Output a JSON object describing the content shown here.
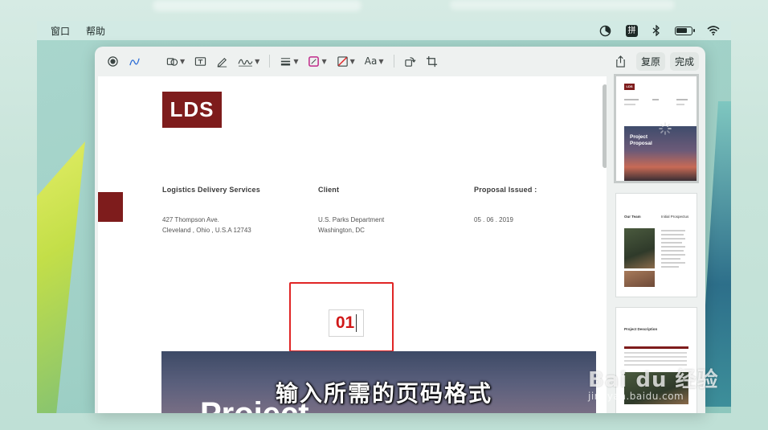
{
  "menubar": {
    "items": [
      "窗口",
      "帮助"
    ]
  },
  "toolbar": {
    "text_style_label": "Aa",
    "revert_label": "复原",
    "done_label": "完成"
  },
  "document": {
    "logo_text": "LDS",
    "columns": [
      {
        "heading": "Logistics Delivery Services",
        "lines": [
          "427 Thompson Ave.",
          "Cleveland , Ohio , U.S.A 12743"
        ]
      },
      {
        "heading": "Client",
        "lines": [
          "U.S. Parks Department",
          "Washington, DC"
        ]
      },
      {
        "heading": "Proposal Issued :",
        "lines": [
          "05 . 06 . 2019"
        ]
      }
    ],
    "page_number_value": "01",
    "hero_text": "Project"
  },
  "thumbnails": [
    {
      "logo": "LDS",
      "title_line1": "Project",
      "title_line2": "Proposal"
    },
    {
      "heading_left": "Our Team",
      "heading_right": "Initial Prospectus"
    },
    {
      "heading": "Project Description"
    }
  ],
  "caption": "输入所需的页码格式",
  "watermark": {
    "main": "Bai du 经验",
    "sub": "jingyan.baidu.com"
  },
  "colors": {
    "brand": "#7e1c1c",
    "highlight": "#e02525",
    "page_number": "#d01818"
  }
}
